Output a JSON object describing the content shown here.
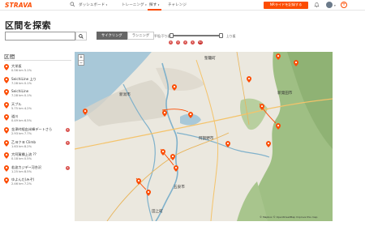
{
  "header": {
    "logo": "STRAVA",
    "nav": [
      {
        "label": "ダッシュボード",
        "caret": "▾"
      },
      {
        "label": "トレーニング",
        "caret": "▾"
      },
      {
        "label": "探す",
        "caret": "▾"
      },
      {
        "label": "チャレンジ",
        "caret": ""
      }
    ],
    "upload_label": "NRライドを記録する",
    "accent_color": "#fc4c02"
  },
  "page_title": "区間を探索",
  "search": {
    "value": "",
    "placeholder": ""
  },
  "activity_tabs": [
    "サイクリング",
    "ランニング"
  ],
  "active_tab": "サイクリング",
  "grade_slider": {
    "left_label": "平坦/下り坂",
    "right_label": "上り坂"
  },
  "grade_badges": [
    "4",
    "3",
    "2",
    "1",
    "HC"
  ],
  "list_header": "区間",
  "segments": [
    {
      "name": "大栄坂",
      "meta": "0.56 km 5.1%",
      "cat": ""
    },
    {
      "name": "SeichiLine 上り",
      "meta": "7.28 km 0.1%",
      "cat": ""
    },
    {
      "name": "SeichiLine",
      "meta": "7.28 km 0.1%",
      "cat": ""
    },
    {
      "name": "天ブル",
      "meta": "5.75 km 4.2%",
      "cat": ""
    },
    {
      "name": "道川",
      "meta": "0.49 km 6.5%",
      "cat": ""
    },
    {
      "name": "金津峠経由米峰デートさら",
      "meta": "2.93 km 7.7%",
      "cat": "4"
    },
    {
      "name": "乙ヨクヨ Climb",
      "meta": "1.63 km 8.2%",
      "cat": "4"
    },
    {
      "name": "大阿賀橋上流 ??",
      "meta": "0.18 km 0.5%",
      "cat": ""
    },
    {
      "name": "若波カジデ~河合沢",
      "meta": "1.25 km 8.5%",
      "cat": "4"
    },
    {
      "name": "ゆよんだ(みぞ)",
      "meta": "2.46 km 7.2%",
      "cat": ""
    }
  ],
  "map": {
    "labels": [
      "聖籠町",
      "新潟市",
      "新発田市",
      "阿賀野市",
      "五泉市",
      "田上町"
    ],
    "attribution": "© Mapbox © OpenStreetMap Improve this map",
    "zoom_in": "+",
    "zoom_out": "−"
  }
}
